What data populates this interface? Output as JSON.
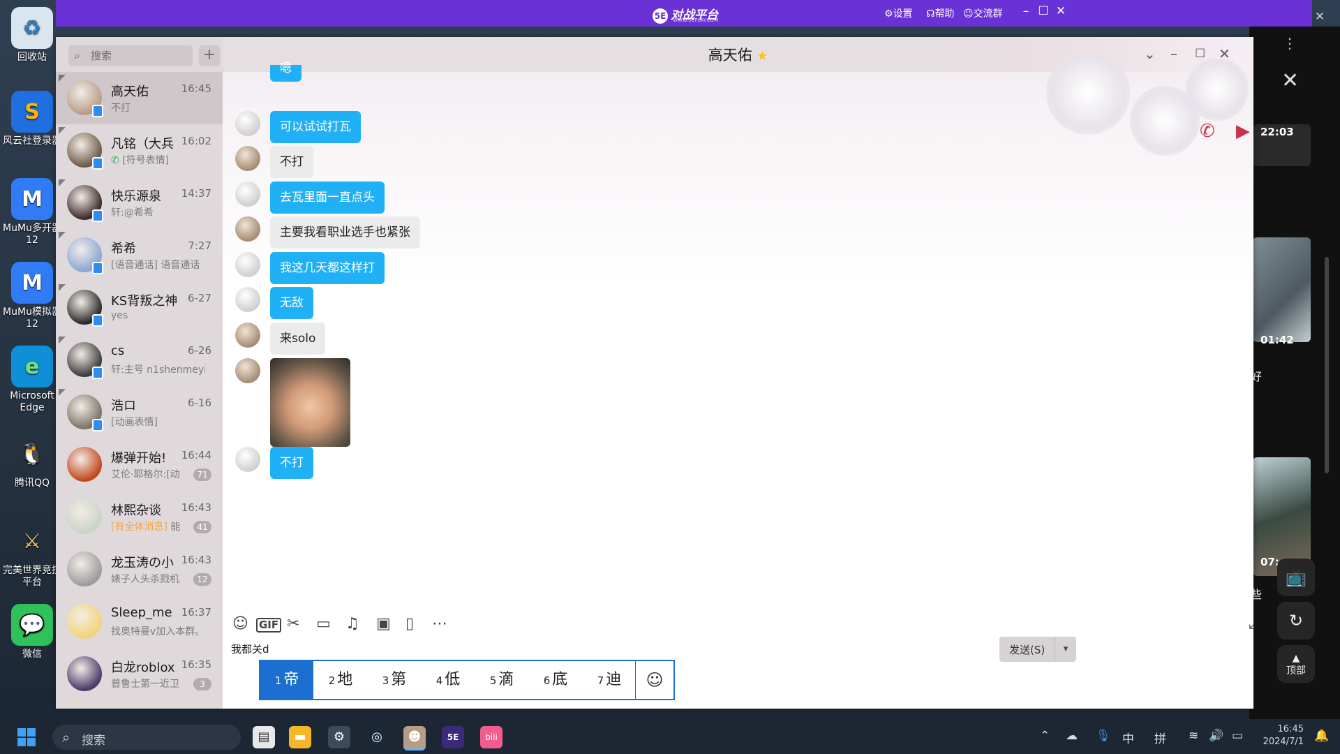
{
  "desktop": {
    "icons": [
      {
        "label": "回收站",
        "glyph": "♻",
        "bg": "#d9e6ef",
        "fg": "#2f7fc3"
      },
      {
        "label": "风云社登录器",
        "glyph": "S",
        "bg": "#1f6fe0",
        "fg": "#ffb400"
      },
      {
        "label": "MuMu多开器12",
        "glyph": "M",
        "bg": "#2f7cf6",
        "fg": "#ffffff"
      },
      {
        "label": "MuMu模拟器12",
        "glyph": "M",
        "bg": "#2f7cf6",
        "fg": "#ffffff"
      },
      {
        "label": "Microsoft Edge",
        "glyph": "e",
        "bg": "#0f8fd6",
        "fg": "#7be07b"
      },
      {
        "label": "腾讯QQ",
        "glyph": "🐧",
        "bg": "transparent",
        "fg": "#ffffff"
      },
      {
        "label": "完美世界竞技平台",
        "glyph": "⚔",
        "bg": "transparent",
        "fg": "#e9c25b"
      },
      {
        "label": "微信",
        "glyph": "💬",
        "bg": "#2fc25b",
        "fg": "#ffffff"
      }
    ]
  },
  "platform": {
    "logo_text": "对战平台",
    "logo_badge": "5E",
    "logo_sub": "WWW.5EPLAY.COM",
    "settings": "设置",
    "help": "帮助",
    "group": "交流群"
  },
  "sidepanel": {
    "times": [
      "22:03",
      "01:42",
      "07:"
    ],
    "text_hao": "好",
    "text_xie": "些",
    "top_btn": "顶部"
  },
  "search": {
    "placeholder": "搜索"
  },
  "contacts": [
    {
      "name": "高天佑",
      "time": "16:45",
      "msg": "不打",
      "active": true,
      "badge": "",
      "av": "#b79d86"
    },
    {
      "name": "凡铭（大兵",
      "time": "16:02",
      "msg": "[符号表情]",
      "phone": true,
      "badge": "",
      "av": "#6d5a48"
    },
    {
      "name": "快乐源泉",
      "time": "14:37",
      "msg": "轩:@希希",
      "badge": "",
      "av": "#3b2b2b"
    },
    {
      "name": "希希",
      "time": "7:27",
      "msg": "[语音通话] 语音通话",
      "badge": "",
      "av": "#8aa7d6"
    },
    {
      "name": "KS背叛之神",
      "time": "6-27",
      "msg": "yes",
      "badge": "",
      "av": "#2a2a2a"
    },
    {
      "name": "cs",
      "time": "6-26",
      "msg": "轩:主号 n1shenmeyi",
      "badge": "",
      "av": "#3c3c3c"
    },
    {
      "name": "浩ロ",
      "time": "6-16",
      "msg": "[动画表情]",
      "badge": "",
      "av": "#7c7466"
    },
    {
      "name": "爆弹开始!",
      "time": "16:44",
      "msg": "艾伦·耶格尔:[动",
      "badge": "71",
      "av": "#c2471c"
    },
    {
      "name": "林熙杂谈",
      "time": "16:43",
      "msg_orange": "[有全体消息]",
      "msg": "能",
      "badge": "41",
      "av": "#c8d4c8"
    },
    {
      "name": "龙玉涛の小",
      "time": "16:43",
      "msg": "婊子人头杀戮机",
      "badge": "12",
      "av": "#9c9c9c"
    },
    {
      "name": "Sleep_me",
      "time": "16:37",
      "msg": "找奥特曼v加入本群。",
      "badge": "",
      "av": "#f1d47a"
    },
    {
      "name": "白龙roblox",
      "time": "16:35",
      "msg": "普鲁士第一近卫",
      "badge": "3",
      "av": "#4b3b6b"
    }
  ],
  "chat": {
    "title": "高天佑",
    "messages": [
      {
        "who": "me",
        "text": "可以试试打瓦"
      },
      {
        "who": "them",
        "text": "不打"
      },
      {
        "who": "me",
        "text": "去瓦里面一直点头"
      },
      {
        "who": "them",
        "text": "主要我看职业选手也紧张"
      },
      {
        "who": "me",
        "text": "我这几天都这样打"
      },
      {
        "who": "me",
        "text": "无敌"
      },
      {
        "who": "them",
        "text": "来solo"
      },
      {
        "who": "them",
        "image": true
      },
      {
        "who": "me",
        "text": "不打"
      }
    ],
    "partial_top": "嗯"
  },
  "input": {
    "typed": "我都关d",
    "candidates": [
      {
        "n": "1",
        "w": "帝"
      },
      {
        "n": "2",
        "w": "地"
      },
      {
        "n": "3",
        "w": "第"
      },
      {
        "n": "4",
        "w": "低"
      },
      {
        "n": "5",
        "w": "滴"
      },
      {
        "n": "6",
        "w": "底"
      },
      {
        "n": "7",
        "w": "迪"
      }
    ],
    "send_label": "发送(S)"
  },
  "taskbar": {
    "search_placeholder": "搜索",
    "tray_ime1": "中",
    "tray_ime2": "拼",
    "time": "16:45",
    "date": "2024/7/1"
  }
}
